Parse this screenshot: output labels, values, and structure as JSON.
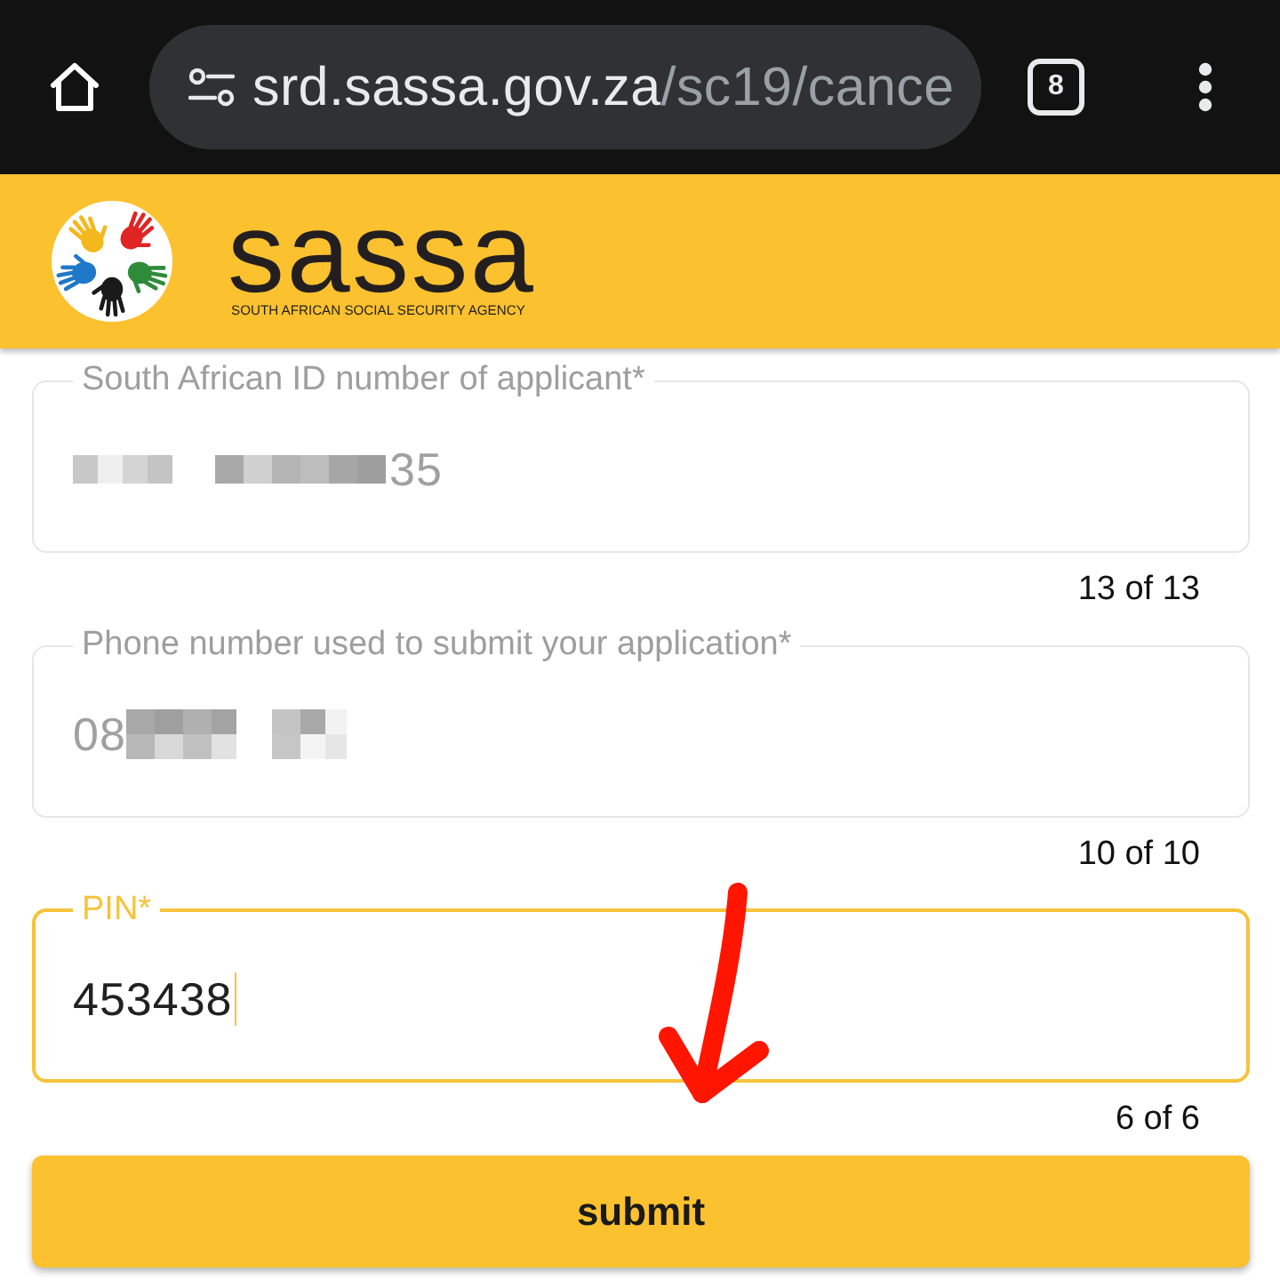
{
  "browser": {
    "url_host": "srd.sassa.gov.za",
    "url_path": "/sc19/cance",
    "tab_count": "8"
  },
  "header": {
    "wordmark": "sassa",
    "tagline": "SOUTH AFRICAN SOCIAL SECURITY AGENCY"
  },
  "fields": [
    {
      "label": "South African ID number of applicant*",
      "value": "35",
      "masked_before": true,
      "masked_after": false,
      "disabled": true,
      "focused": false,
      "counter": "13 of 13"
    },
    {
      "label": "Phone number used to submit your application*",
      "value": "08",
      "masked_before": false,
      "masked_after": true,
      "disabled": true,
      "focused": false,
      "counter": "10 of 10"
    },
    {
      "label": "PIN*",
      "value": "453438",
      "masked_before": false,
      "masked_after": false,
      "disabled": false,
      "focused": true,
      "counter": "6 of 6"
    }
  ],
  "submit_button": {
    "label": "submit"
  }
}
